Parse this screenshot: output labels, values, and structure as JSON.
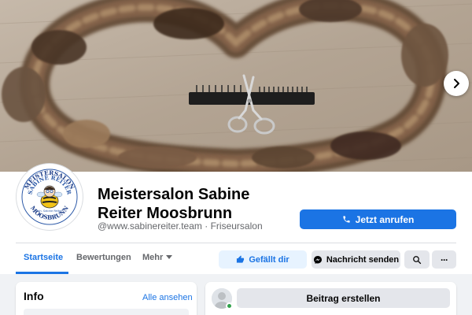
{
  "page": {
    "name": "Meistersalon Sabine Reiter Moosbrunn",
    "handle": "@www.sabinereiter.team",
    "category": "Friseursalon",
    "separator": "·"
  },
  "logo": {
    "top_text": "MEISTERSALON",
    "ring_text": "SABINE REITER",
    "sub_text": "Inh. Sabine Reiter",
    "bottom_text": "MOOSBRUNN"
  },
  "buttons": {
    "call": "Jetzt anrufen",
    "like": "Gefällt dir",
    "message": "Nachricht senden",
    "more_dots": "···"
  },
  "tabs": [
    {
      "label": "Startseite",
      "active": true
    },
    {
      "label": "Bewertungen",
      "active": false
    },
    {
      "label": "Mehr",
      "active": false
    }
  ],
  "info": {
    "title": "Info",
    "see_all": "Alle ansehen"
  },
  "composer": {
    "create_post": "Beitrag erstellen"
  },
  "colors": {
    "accent": "#1b74e4",
    "page_bg": "#f0f2f5",
    "online": "#31a24c"
  },
  "icons": [
    "chevron-right-icon",
    "phone-icon",
    "thumbs-up-icon",
    "messenger-icon",
    "search-icon",
    "more-icon",
    "caret-down-icon",
    "user-avatar-icon"
  ]
}
